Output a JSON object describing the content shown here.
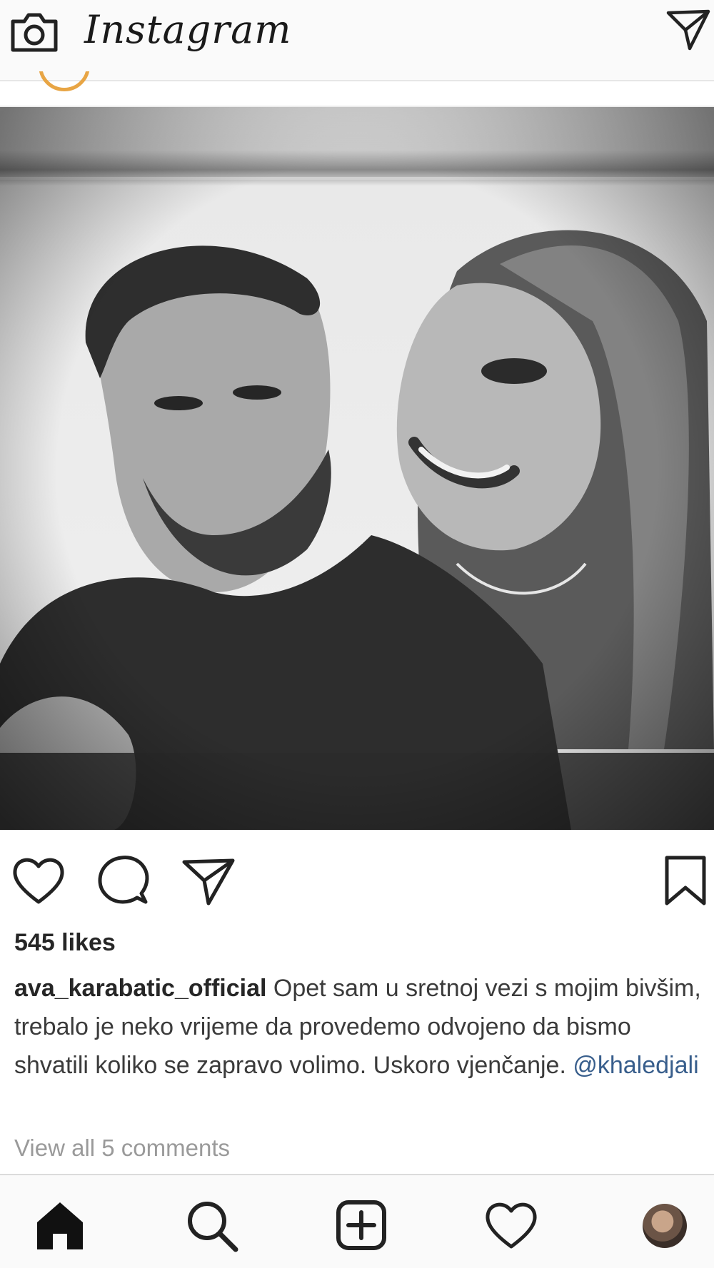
{
  "header": {
    "app_title": "Instagram",
    "camera_icon": "camera-icon",
    "direct_icon": "paper-plane-icon"
  },
  "post": {
    "likes": "545 likes",
    "caption": {
      "username": "ava_karabatic_official",
      "text": " Opet sam u sretnoj vezi s mojim bivšim, trebalo je neko vrijeme da provedemo odvojeno da bismo shvatili koliko se zapravo volimo. Uskoro vjenčanje. ",
      "mention": "@khaledjali"
    },
    "view_comments": "View all 5 comments",
    "actions": [
      "heart-icon",
      "comment-icon",
      "share-icon",
      "bookmark-icon"
    ]
  },
  "bottom_nav": {
    "items": [
      "home-icon",
      "search-icon",
      "new-post-icon",
      "activity-heart-icon",
      "profile-avatar"
    ]
  },
  "colors": {
    "mention": "#385e8c",
    "story_ring": "#e8a544",
    "muted": "#9a9a9a"
  }
}
